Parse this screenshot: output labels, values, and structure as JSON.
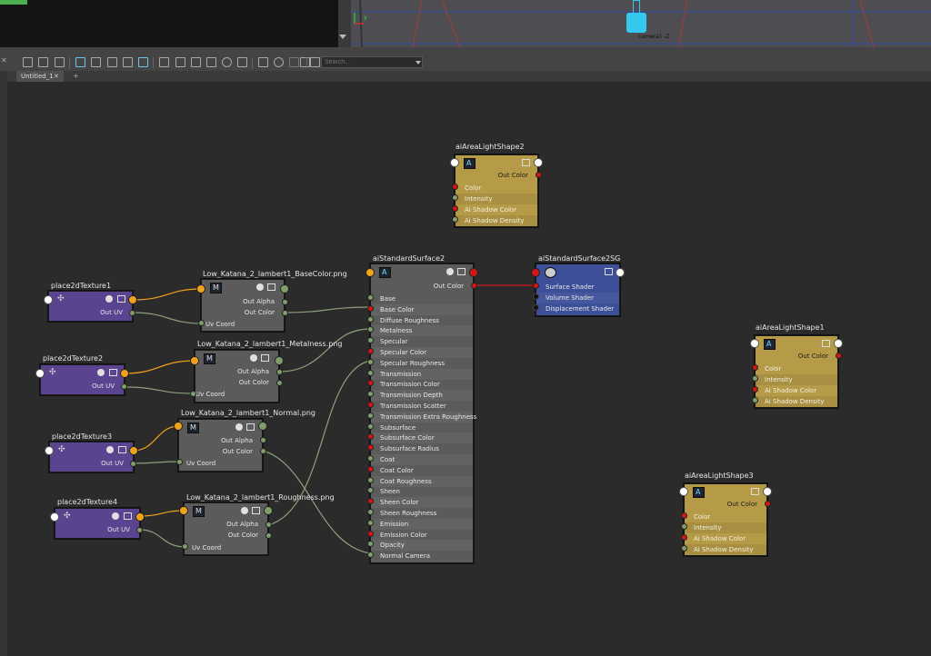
{
  "viewport": {
    "camera_label": "camera1 -Z",
    "axis_label": "y"
  },
  "toolbar": {
    "search_placeholder": "Search..."
  },
  "tabs": [
    {
      "label": "Untitled_1",
      "close": "✕"
    }
  ],
  "tab_add": "+",
  "panel_close": "✕",
  "nodes": {
    "place2d1": {
      "title": "place2dTexture1",
      "out": "Out UV"
    },
    "place2d2": {
      "title": "place2dTexture2",
      "out": "Out UV"
    },
    "place2d3": {
      "title": "place2dTexture3",
      "out": "Out UV"
    },
    "place2d4": {
      "title": "place2dTexture4",
      "out": "Out UV"
    },
    "file_base": {
      "title": "Low_Katana_2_lambert1_BaseColor.png",
      "rows": [
        "Out Alpha",
        "Out Color"
      ],
      "in": "Uv Coord"
    },
    "file_metal": {
      "title": "Low_Katana_2_lambert1_Metalness.png",
      "rows": [
        "Out Alpha",
        "Out Color"
      ],
      "in": "Uv Coord"
    },
    "file_normal": {
      "title": "Low_Katana_2_lambert1_Normal.png",
      "rows": [
        "Out Alpha",
        "Out Color"
      ],
      "in": "Uv Coord"
    },
    "file_rough": {
      "title": "Low_Katana_2_lambert1_Roughness.png",
      "rows": [
        "Out Alpha",
        "Out Color"
      ],
      "in": "Uv Coord"
    },
    "std": {
      "title": "aiStandardSurface2",
      "out": "Out Color",
      "attrs": [
        "Base",
        "Base Color",
        "Diffuse Roughness",
        "Metalness",
        "Specular",
        "Specular Color",
        "Specular Roughness",
        "Transmission",
        "Transmission Color",
        "Transmission Depth",
        "Transmission Scatter",
        "Transmission Extra Roughness",
        "Subsurface",
        "Subsurface Color",
        "Subsurface Radius",
        "Coat",
        "Coat Color",
        "Coat Roughness",
        "Sheen",
        "Sheen Color",
        "Sheen Roughness",
        "Emission",
        "Emission Color",
        "Opacity",
        "Normal Camera"
      ]
    },
    "sg": {
      "title": "aiStandardSurface2SG",
      "attrs": [
        "Surface Shader",
        "Volume Shader",
        "Displacement Shader"
      ]
    },
    "light2": {
      "title": "aiAreaLightShape2",
      "out": "Out Color",
      "attrs": [
        "Color",
        "Intensity",
        "Ai Shadow Color",
        "Ai Shadow Density"
      ]
    },
    "light1": {
      "title": "aiAreaLightShape1",
      "out": "Out Color",
      "attrs": [
        "Color",
        "Intensity",
        "Ai Shadow Color",
        "Ai Shadow Density"
      ]
    },
    "light3": {
      "title": "aiAreaLightShape3",
      "out": "Out Color",
      "attrs": [
        "Color",
        "Intensity",
        "Ai Shadow Color",
        "Ai Shadow Density"
      ]
    }
  },
  "colors": {
    "wire_uv": "#f0a21b",
    "wire_color": "#8da07d",
    "wire_shader": "#d11616",
    "node_place": "#5a448f",
    "node_file": "#5b5b5b",
    "node_light": "#b59a47",
    "node_sg": "#3c4f98"
  }
}
